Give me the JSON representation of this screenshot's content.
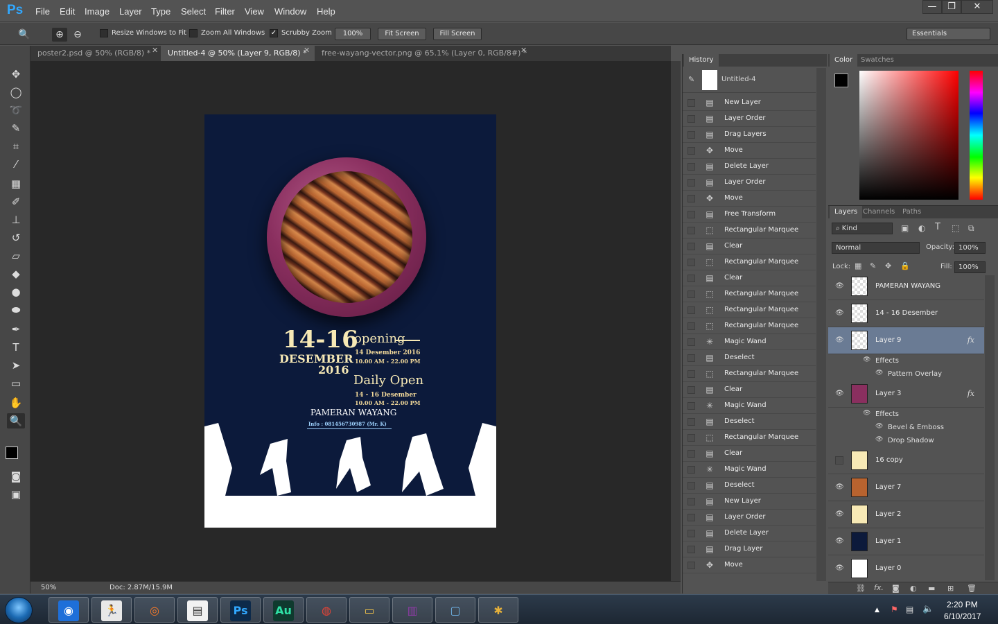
{
  "app": {
    "logo": "Ps"
  },
  "menu": [
    "File",
    "Edit",
    "Image",
    "Layer",
    "Type",
    "Select",
    "Filter",
    "View",
    "Window",
    "Help"
  ],
  "window_controls": {
    "minimize": "—",
    "maximize": "❐",
    "close": "✕"
  },
  "options": {
    "resize_windows": "Resize Windows to Fit",
    "zoom_all": "Zoom All Windows",
    "scrubby_zoom": "Scrubby Zoom",
    "btn_100": "100%",
    "btn_fit": "Fit Screen",
    "btn_fill": "Fill Screen",
    "workspace": "Essentials"
  },
  "tabs": [
    {
      "label": "poster2.psd @ 50% (RGB/8) *"
    },
    {
      "label": "Untitled-4 @ 50% (Layer 9, RGB/8) *"
    },
    {
      "label": "free-wayang-vector.png @ 65.1% (Layer 0, RGB/8#) *"
    }
  ],
  "status": {
    "zoom": "50%",
    "doc": "Doc: 2.87M/15.9M"
  },
  "poster": {
    "dates_big": "14-16",
    "month": "DESEMBER",
    "year": "2016",
    "opening": "opening",
    "opening_date": "14 Desember 2016",
    "opening_time": "10.00 AM - 22.00 PM",
    "daily": "Daily Open",
    "daily_date": "14 - 16 Desember",
    "daily_time": "10.00 AM - 22.00 PM",
    "event": "PAMERAN WAYANG",
    "info": "Info : 081456730987 (Mr. K)"
  },
  "history": {
    "tab": "History",
    "snapshot": "Untitled-4",
    "items": [
      {
        "label": "New Layer",
        "icon": "doc-icon"
      },
      {
        "label": "Layer Order",
        "icon": "doc-icon"
      },
      {
        "label": "Drag Layers",
        "icon": "doc-icon"
      },
      {
        "label": "Move",
        "icon": "move-icon"
      },
      {
        "label": "Delete Layer",
        "icon": "doc-icon"
      },
      {
        "label": "Layer Order",
        "icon": "doc-icon"
      },
      {
        "label": "Move",
        "icon": "move-icon"
      },
      {
        "label": "Free Transform",
        "icon": "doc-icon"
      },
      {
        "label": "Rectangular Marquee",
        "icon": "marquee-icon"
      },
      {
        "label": "Clear",
        "icon": "doc-icon"
      },
      {
        "label": "Rectangular Marquee",
        "icon": "marquee-icon"
      },
      {
        "label": "Clear",
        "icon": "doc-icon"
      },
      {
        "label": "Rectangular Marquee",
        "icon": "marquee-icon"
      },
      {
        "label": "Rectangular Marquee",
        "icon": "marquee-icon"
      },
      {
        "label": "Rectangular Marquee",
        "icon": "marquee-icon"
      },
      {
        "label": "Magic Wand",
        "icon": "wand-icon"
      },
      {
        "label": "Deselect",
        "icon": "doc-icon"
      },
      {
        "label": "Rectangular Marquee",
        "icon": "marquee-icon"
      },
      {
        "label": "Clear",
        "icon": "doc-icon"
      },
      {
        "label": "Magic Wand",
        "icon": "wand-icon"
      },
      {
        "label": "Deselect",
        "icon": "doc-icon"
      },
      {
        "label": "Rectangular Marquee",
        "icon": "marquee-icon"
      },
      {
        "label": "Clear",
        "icon": "doc-icon"
      },
      {
        "label": "Magic Wand",
        "icon": "wand-icon"
      },
      {
        "label": "Deselect",
        "icon": "doc-icon"
      },
      {
        "label": "New Layer",
        "icon": "doc-icon"
      },
      {
        "label": "Layer Order",
        "icon": "doc-icon"
      },
      {
        "label": "Delete Layer",
        "icon": "doc-icon"
      },
      {
        "label": "Drag Layer",
        "icon": "doc-icon"
      },
      {
        "label": "Move",
        "icon": "move-icon"
      }
    ]
  },
  "color_panel": {
    "tab_color": "Color",
    "tab_swatches": "Swatches",
    "foreground": "#000000",
    "background": "#ffffff"
  },
  "layers_panel": {
    "tab_layers": "Layers",
    "tab_channels": "Channels",
    "tab_paths": "Paths",
    "kind": "Kind",
    "blend": "Normal",
    "opacity_label": "Opacity:",
    "opacity": "100%",
    "lock_label": "Lock:",
    "fill_label": "Fill:",
    "fill": "100%",
    "effects_label": "Effects",
    "layers": [
      {
        "name": "PAMERAN WAYANG",
        "visible": true
      },
      {
        "name": "14 - 16 Desember",
        "visible": true
      },
      {
        "name": "Layer 9",
        "visible": true,
        "selected": true,
        "fx": "fx",
        "effects": [
          "Pattern Overlay"
        ]
      },
      {
        "name": "Layer 3",
        "visible": true,
        "fx": "fx",
        "effects": [
          "Bevel & Emboss",
          "Drop Shadow"
        ]
      },
      {
        "name": "16 copy",
        "visible": false
      },
      {
        "name": "Layer 7",
        "visible": true
      },
      {
        "name": "Layer 2",
        "visible": true
      },
      {
        "name": "Layer 1",
        "visible": true
      },
      {
        "name": "Layer 0",
        "visible": true
      }
    ]
  },
  "taskbar": {
    "apps": [
      {
        "name": "media-player-icon",
        "label": ""
      },
      {
        "name": "pedestrian-app-icon",
        "label": ""
      },
      {
        "name": "blender-icon",
        "label": ""
      },
      {
        "name": "notepad-icon",
        "label": ""
      },
      {
        "name": "photoshop-icon",
        "label": "Ps"
      },
      {
        "name": "audition-icon",
        "label": "Au"
      },
      {
        "name": "chrome-icon",
        "label": ""
      },
      {
        "name": "explorer-icon",
        "label": ""
      },
      {
        "name": "winrar-icon",
        "label": ""
      },
      {
        "name": "photo-viewer-icon",
        "label": ""
      },
      {
        "name": "paint-icon",
        "label": ""
      }
    ],
    "time": "2:20 PM",
    "date": "6/10/2017"
  }
}
